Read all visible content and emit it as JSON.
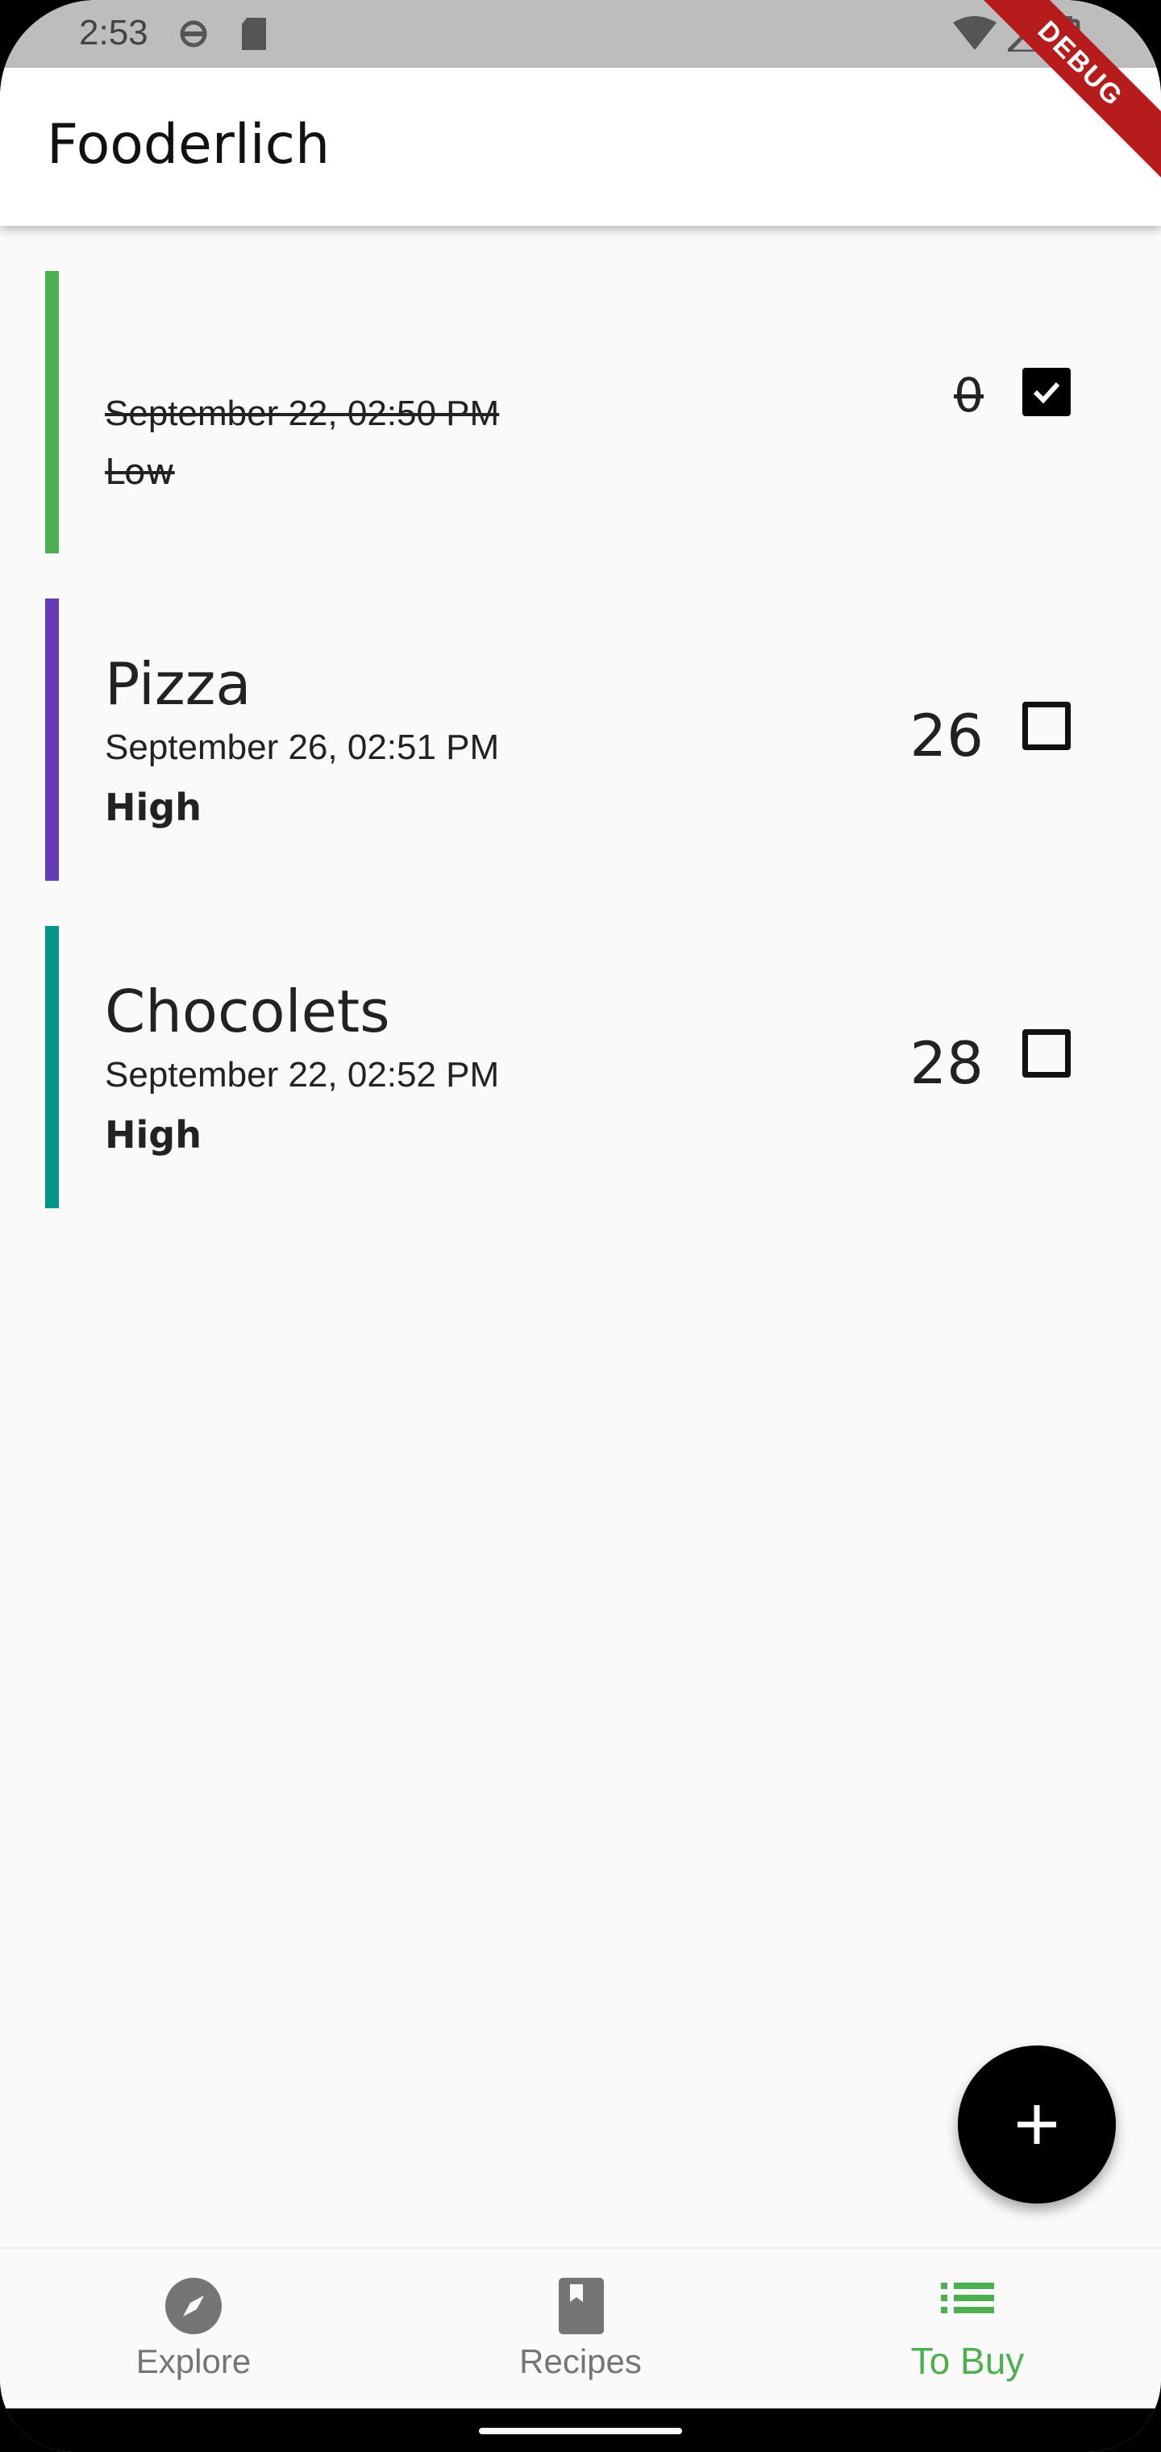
{
  "status_bar": {
    "time": "2:53"
  },
  "app_bar": {
    "title": "Fooderlich",
    "debug_label": "DEBUG"
  },
  "items": [
    {
      "name": "",
      "date": "September 22, 02:50 PM",
      "importance": "Low",
      "quantity": "0",
      "checked": true,
      "color": "#4caf50"
    },
    {
      "name": "Pizza",
      "date": "September 26, 02:51 PM",
      "importance": "High",
      "quantity": "26",
      "checked": false,
      "color": "#673ab7"
    },
    {
      "name": "Chocolets",
      "date": "September 22, 02:52 PM",
      "importance": "High",
      "quantity": "28",
      "checked": false,
      "color": "#009688"
    }
  ],
  "fab": {
    "icon": "add-icon"
  },
  "bottom_nav": {
    "items": [
      {
        "label": "Explore",
        "icon": "compass-icon",
        "active": false
      },
      {
        "label": "Recipes",
        "icon": "book-icon",
        "active": false
      },
      {
        "label": "To Buy",
        "icon": "list-icon",
        "active": true
      }
    ]
  },
  "colors": {
    "accent": "#4caf50",
    "fab": "#000000"
  }
}
